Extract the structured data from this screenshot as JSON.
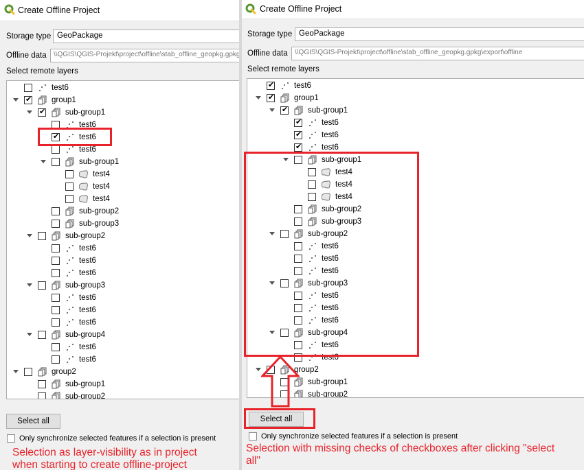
{
  "colors": {
    "annotation": "#e8222a",
    "qgis_green": "#589632",
    "qgis_yellow": "#f0c028"
  },
  "left": {
    "window_title": "Create Offline Project",
    "storage_label": "Storage type",
    "storage_value": "GeoPackage",
    "offline_label": "Offline data",
    "offline_path": "\\\\QGIS\\QGIS-Projekt\\project\\offline\\stab_offline_geopkg.gpkg",
    "layers_label": "Select remote layers",
    "select_all": "Select all",
    "sync_label": "Only synchronize selected features if a selection is present",
    "caption_line1": "Selection as layer-visibility as in project",
    "caption_line2": "when starting to create offline-project"
  },
  "right": {
    "window_title": "Create Offline Project",
    "storage_label": "Storage type",
    "storage_value": "GeoPackage",
    "offline_label": "Offline data",
    "offline_path": "\\\\QGIS\\QGIS-Projekt\\project\\offline\\stab_offline_geopkg.gpkg\\export\\offline",
    "layers_label": "Select remote layers",
    "select_all": "Select all",
    "sync_label": "Only synchronize selected features if a selection is present",
    "caption_line1": "Selection with missing checks of checkboxes after clicking \"select",
    "caption_line2": "all\""
  },
  "left_tree": [
    {
      "label": "test6",
      "level": 0,
      "expand": false,
      "checked": false,
      "icon": "point-layer-icon"
    },
    {
      "label": "group1",
      "level": 0,
      "expand": true,
      "checked": true,
      "icon": "group-icon"
    },
    {
      "label": "sub-group1",
      "level": 1,
      "expand": true,
      "checked": true,
      "icon": "group-icon"
    },
    {
      "label": "test6",
      "level": 2,
      "expand": false,
      "checked": false,
      "icon": "point-layer-icon"
    },
    {
      "label": "test6",
      "level": 2,
      "expand": false,
      "checked": true,
      "icon": "point-layer-icon"
    },
    {
      "label": "test6",
      "level": 2,
      "expand": false,
      "checked": false,
      "icon": "point-layer-icon"
    },
    {
      "label": "sub-group1",
      "level": 2,
      "expand": true,
      "checked": false,
      "icon": "group-icon"
    },
    {
      "label": "test4",
      "level": 3,
      "expand": false,
      "checked": false,
      "icon": "polygon-layer-icon"
    },
    {
      "label": "test4",
      "level": 3,
      "expand": false,
      "checked": false,
      "icon": "polygon-layer-icon"
    },
    {
      "label": "test4",
      "level": 3,
      "expand": false,
      "checked": false,
      "icon": "polygon-layer-icon"
    },
    {
      "label": "sub-group2",
      "level": 2,
      "expand": false,
      "checked": false,
      "icon": "group-icon"
    },
    {
      "label": "sub-group3",
      "level": 2,
      "expand": false,
      "checked": false,
      "icon": "group-icon"
    },
    {
      "label": "sub-group2",
      "level": 1,
      "expand": true,
      "checked": false,
      "icon": "group-icon"
    },
    {
      "label": "test6",
      "level": 2,
      "expand": false,
      "checked": false,
      "icon": "point-layer-icon"
    },
    {
      "label": "test6",
      "level": 2,
      "expand": false,
      "checked": false,
      "icon": "point-layer-icon"
    },
    {
      "label": "test6",
      "level": 2,
      "expand": false,
      "checked": false,
      "icon": "point-layer-icon"
    },
    {
      "label": "sub-group3",
      "level": 1,
      "expand": true,
      "checked": false,
      "icon": "group-icon"
    },
    {
      "label": "test6",
      "level": 2,
      "expand": false,
      "checked": false,
      "icon": "point-layer-icon"
    },
    {
      "label": "test6",
      "level": 2,
      "expand": false,
      "checked": false,
      "icon": "point-layer-icon"
    },
    {
      "label": "test6",
      "level": 2,
      "expand": false,
      "checked": false,
      "icon": "point-layer-icon"
    },
    {
      "label": "sub-group4",
      "level": 1,
      "expand": true,
      "checked": false,
      "icon": "group-icon"
    },
    {
      "label": "test6",
      "level": 2,
      "expand": false,
      "checked": false,
      "icon": "point-layer-icon"
    },
    {
      "label": "test6",
      "level": 2,
      "expand": false,
      "checked": false,
      "icon": "point-layer-icon"
    },
    {
      "label": "group2",
      "level": 0,
      "expand": true,
      "checked": false,
      "icon": "group-icon"
    },
    {
      "label": "sub-group1",
      "level": 1,
      "expand": false,
      "checked": false,
      "icon": "group-icon"
    },
    {
      "label": "sub-group2",
      "level": 1,
      "expand": false,
      "checked": false,
      "icon": "group-icon"
    }
  ],
  "right_tree": [
    {
      "label": "test6",
      "level": 0,
      "expand": false,
      "checked": true,
      "icon": "point-layer-icon"
    },
    {
      "label": "group1",
      "level": 0,
      "expand": true,
      "checked": true,
      "icon": "group-icon"
    },
    {
      "label": "sub-group1",
      "level": 1,
      "expand": true,
      "checked": true,
      "icon": "group-icon"
    },
    {
      "label": "test6",
      "level": 2,
      "expand": false,
      "checked": true,
      "icon": "point-layer-icon"
    },
    {
      "label": "test6",
      "level": 2,
      "expand": false,
      "checked": true,
      "icon": "point-layer-icon"
    },
    {
      "label": "test6",
      "level": 2,
      "expand": false,
      "checked": true,
      "icon": "point-layer-icon"
    },
    {
      "label": "sub-group1",
      "level": 2,
      "expand": true,
      "checked": false,
      "icon": "group-icon"
    },
    {
      "label": "test4",
      "level": 3,
      "expand": false,
      "checked": false,
      "icon": "polygon-layer-icon"
    },
    {
      "label": "test4",
      "level": 3,
      "expand": false,
      "checked": false,
      "icon": "polygon-layer-icon"
    },
    {
      "label": "test4",
      "level": 3,
      "expand": false,
      "checked": false,
      "icon": "polygon-layer-icon"
    },
    {
      "label": "sub-group2",
      "level": 2,
      "expand": false,
      "checked": false,
      "icon": "group-icon"
    },
    {
      "label": "sub-group3",
      "level": 2,
      "expand": false,
      "checked": false,
      "icon": "group-icon"
    },
    {
      "label": "sub-group2",
      "level": 1,
      "expand": true,
      "checked": false,
      "icon": "group-icon"
    },
    {
      "label": "test6",
      "level": 2,
      "expand": false,
      "checked": false,
      "icon": "point-layer-icon"
    },
    {
      "label": "test6",
      "level": 2,
      "expand": false,
      "checked": false,
      "icon": "point-layer-icon"
    },
    {
      "label": "test6",
      "level": 2,
      "expand": false,
      "checked": false,
      "icon": "point-layer-icon"
    },
    {
      "label": "sub-group3",
      "level": 1,
      "expand": true,
      "checked": false,
      "icon": "group-icon"
    },
    {
      "label": "test6",
      "level": 2,
      "expand": false,
      "checked": false,
      "icon": "point-layer-icon"
    },
    {
      "label": "test6",
      "level": 2,
      "expand": false,
      "checked": false,
      "icon": "point-layer-icon"
    },
    {
      "label": "test6",
      "level": 2,
      "expand": false,
      "checked": false,
      "icon": "point-layer-icon"
    },
    {
      "label": "sub-group4",
      "level": 1,
      "expand": true,
      "checked": false,
      "icon": "group-icon"
    },
    {
      "label": "test6",
      "level": 2,
      "expand": false,
      "checked": false,
      "icon": "point-layer-icon"
    },
    {
      "label": "test6",
      "level": 2,
      "expand": false,
      "checked": false,
      "icon": "point-layer-icon"
    },
    {
      "label": "group2",
      "level": 0,
      "expand": true,
      "checked": false,
      "icon": "group-icon"
    },
    {
      "label": "sub-group1",
      "level": 1,
      "expand": false,
      "checked": false,
      "icon": "group-icon"
    },
    {
      "label": "sub-group2",
      "level": 1,
      "expand": false,
      "checked": false,
      "icon": "group-icon"
    }
  ]
}
